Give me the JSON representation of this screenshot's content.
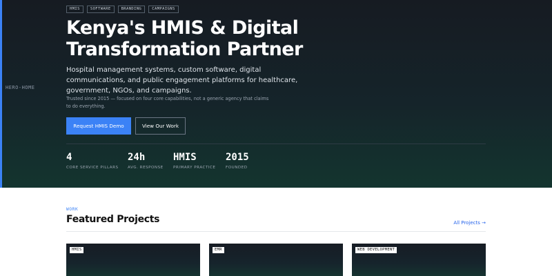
{
  "hero": {
    "side_label": "HERO-HOME",
    "tags": [
      "HMIS",
      "SOFTWARE",
      "BRANDING",
      "CAMPAIGNS"
    ],
    "title": "Kenya's HMIS & Digital Transformation Partner",
    "lead": "Hospital management systems, custom software, digital communications, and public engagement platforms for healthcare, government, NGOs, and campaigns.",
    "note": "Trusted since 2015 — focused on four core capabilities, not a generic agency that claims to do everything.",
    "primary_cta": "Request HMIS Demo",
    "secondary_cta": "View Our Work",
    "stats": [
      {
        "value": "4",
        "label": "CORE SERVICE PILLARS"
      },
      {
        "value": "24h",
        "label": "AVG. RESPONSE"
      },
      {
        "value": "HMIS",
        "label": "PRIMARY PRACTICE"
      },
      {
        "value": "2015",
        "label": "FOUNDED"
      }
    ]
  },
  "work": {
    "eyebrow": "WORK",
    "title": "Featured Projects",
    "all_link": "All Projects →",
    "cards": [
      {
        "badge": "HMIS"
      },
      {
        "badge": "EMR"
      },
      {
        "badge": "WEB DEVELOPMENT"
      }
    ]
  },
  "colors": {
    "accent": "#3b82f6",
    "hero_bg_top": "#161b22",
    "hero_bg_bottom": "#14352f"
  }
}
